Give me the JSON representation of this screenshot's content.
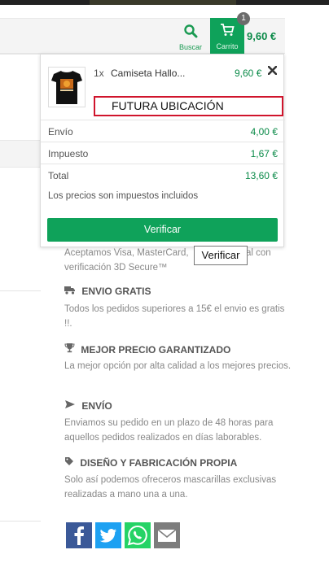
{
  "header": {
    "search_label": "Buscar",
    "search_icon": "search-icon",
    "cart_label": "Carrito",
    "cart_icon": "shopping-cart-icon",
    "cart_count": "1",
    "cart_total": "9,60 €"
  },
  "mini_cart": {
    "item": {
      "qty": "1x",
      "name": "Camiseta Hallo...",
      "price": "9,60 €",
      "remove_icon": "close-icon"
    },
    "placeholder_text": "FUTURA UBICACIÓN",
    "summary": [
      {
        "label": "Envío",
        "value": "4,00 €"
      },
      {
        "label": "Impuesto",
        "value": "1,67 €"
      },
      {
        "label": "Total",
        "value": "13,60 €"
      }
    ],
    "note": "Los precios son impuestos incluidos",
    "checkout_label": "Verificar"
  },
  "tooltip": "Verificar",
  "payment_text_left": "Aceptamos Visa, MasterCard,",
  "payment_text_right": "pal con",
  "payment_text_line2": "verificación 3D Secure™",
  "features": [
    {
      "icon": "truck-icon",
      "title": "ENVIO GRATIS",
      "text": "Todos los pedidos superiores a 15€ el envio es gratis !!."
    },
    {
      "icon": "trophy-icon",
      "title": "MEJOR PRECIO GARANTIZADO",
      "text": "La mejor opción por alta calidad a los mejores precios."
    },
    {
      "icon": "plane-icon",
      "title": "ENVÍO",
      "text": "Enviamos su pedido en un plazo de 48 horas para aquellos pedidos realizados en días laborables."
    },
    {
      "icon": "tag-icon",
      "title": "DISEÑO Y FABRICACIÓN PROPIA",
      "text": "Solo así podemos ofreceros mascarillas exclusivas realizadas a mano una a una."
    }
  ],
  "social": [
    {
      "icon": "facebook-icon",
      "color": "#3b5998"
    },
    {
      "icon": "twitter-icon",
      "color": "#1da1f2"
    },
    {
      "icon": "whatsapp-icon",
      "color": "#25d366"
    },
    {
      "icon": "email-icon",
      "color": "#7d7d7d"
    }
  ],
  "colors": {
    "accent": "#0fa25a",
    "price": "#0a8a48",
    "highlight_border": "#d0142c"
  }
}
